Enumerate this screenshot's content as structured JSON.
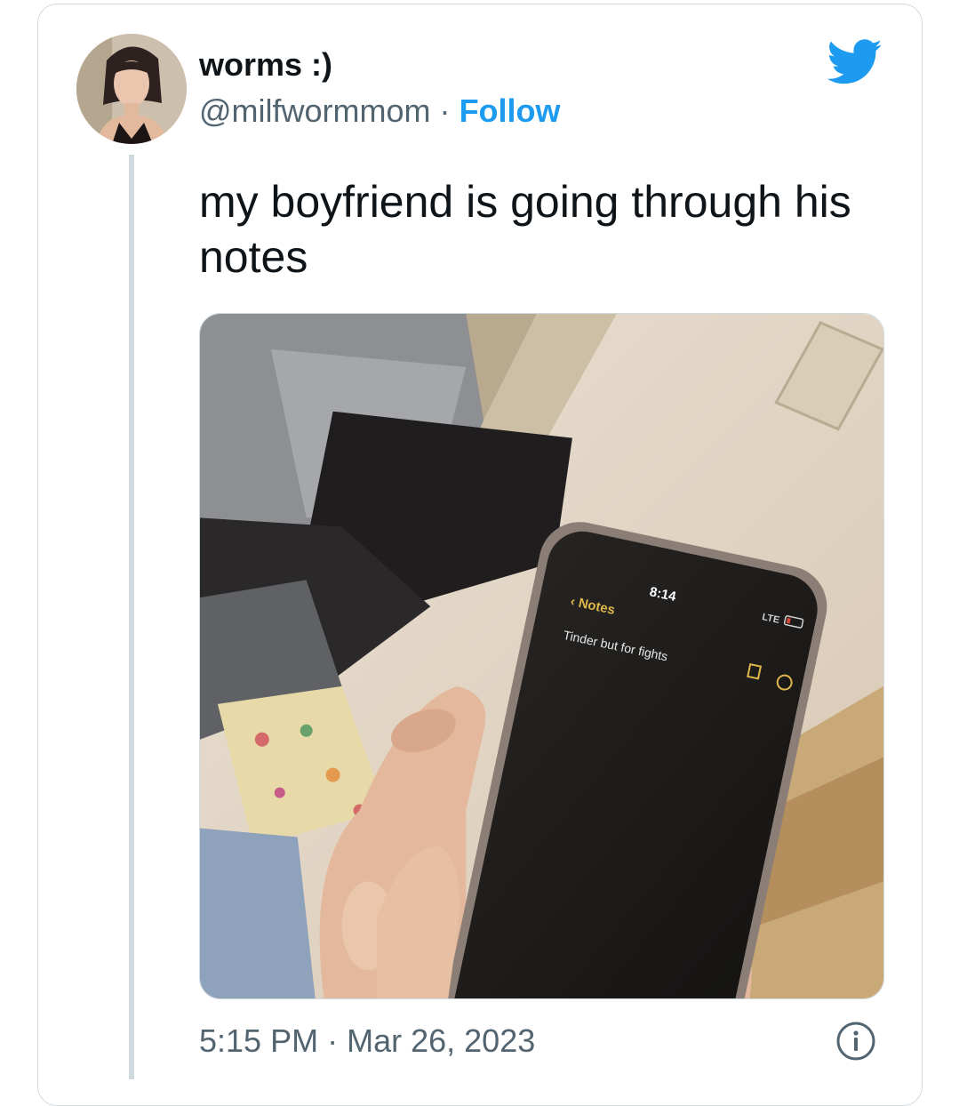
{
  "tweet": {
    "author": {
      "display_name": "worms :)",
      "handle": "@milfwormmom",
      "separator": "·",
      "follow_label": "Follow"
    },
    "text": "my boyfriend is going through his notes",
    "media": {
      "phone_time": "8:14",
      "back_label": "Notes",
      "note_text": "Tinder but for fights",
      "network": "LTE"
    },
    "time": "5:15 PM",
    "date": "Mar 26, 2023"
  },
  "icons": {
    "brand": "twitter-bird-icon",
    "info": "info-icon"
  },
  "colors": {
    "accent": "#1d9bf0",
    "text": "#0f1419",
    "secondary": "#536471",
    "border": "#cfd9de"
  }
}
